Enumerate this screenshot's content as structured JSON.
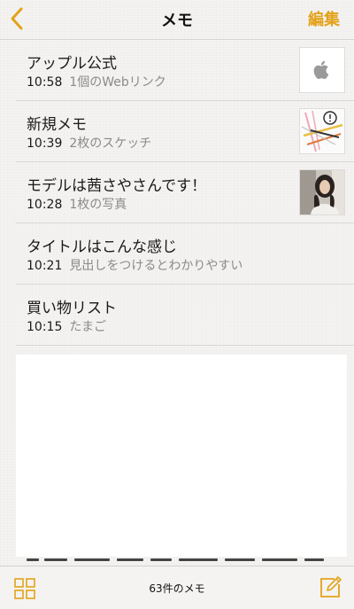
{
  "header": {
    "title": "メモ",
    "edit_label": "編集",
    "back_icon": "chevron-left-icon",
    "accent_color": "#e3a21a"
  },
  "notes": [
    {
      "title": "アップル公式",
      "time": "10:58",
      "preview": "1個のWebリンク",
      "thumbnail": "apple-logo"
    },
    {
      "title": "新規メモ",
      "time": "10:39",
      "preview": "2枚のスケッチ",
      "thumbnail": "sketch"
    },
    {
      "title": "モデルは茜さやさんです！",
      "time": "10:28",
      "preview": "1枚の写真",
      "thumbnail": "photo"
    },
    {
      "title": "タイトルはこんな感じ",
      "time": "10:21",
      "preview": "見出しをつけるとわかりやすい"
    },
    {
      "title": "買い物リスト",
      "time": "10:15",
      "preview": "たまご"
    }
  ],
  "toolbar": {
    "count_label": "63件のメモ",
    "grid_icon": "attachments-grid-icon",
    "compose_icon": "compose-icon"
  }
}
